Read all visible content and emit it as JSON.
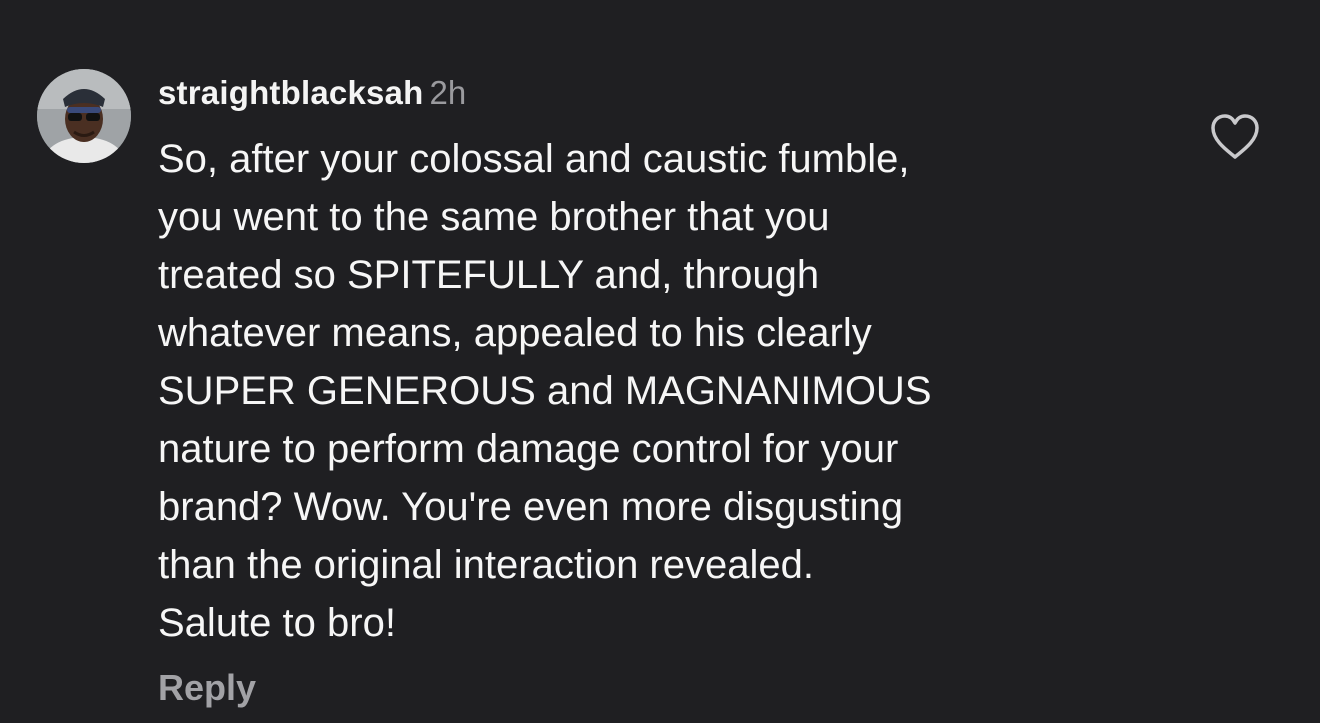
{
  "comment": {
    "username": "straightblacksah",
    "timestamp": "2h",
    "avatar_icon": "user-avatar-photo",
    "body_lines": [
      "So, after your colossal and caustic fumble,",
      "you went to the same brother that you",
      "treated so SPITEFULLY and, through",
      "whatever means, appealed to his clearly",
      "SUPER GENEROUS and MAGNANIMOUS",
      "nature to perform damage control for your",
      "brand? Wow. You're even more disgusting",
      "than the original interaction revealed.",
      "Salute to bro!"
    ],
    "reply_label": "Reply",
    "like_icon": "heart-outline-icon"
  },
  "colors": {
    "background": "#1f1f22",
    "primary_text": "#f6f6f6",
    "secondary_text": "#9a9a9e"
  }
}
